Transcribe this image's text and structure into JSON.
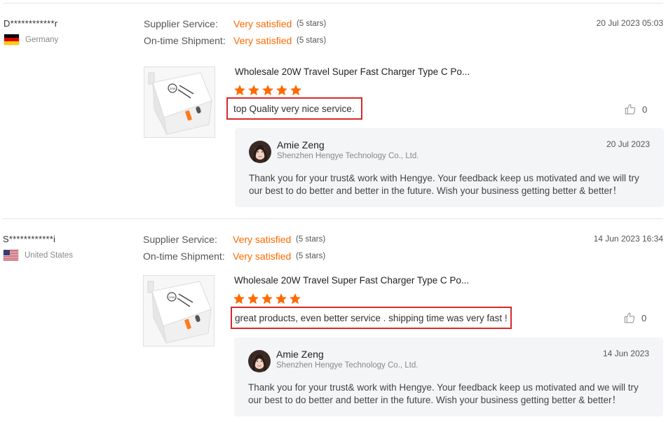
{
  "colors": {
    "accent": "#ff6a00",
    "highlight_border": "#d62a2a",
    "reply_bg": "#f4f5f7",
    "divider": "#e5e5e5"
  },
  "reviews": [
    {
      "buyer": "D************r",
      "country": "Germany",
      "flag_icon": "germany-flag-icon",
      "metrics": [
        {
          "label": "Supplier Service:",
          "value": "Very satisfied",
          "stars": "(5 stars)"
        },
        {
          "label": "On-time Shipment:",
          "value": "Very satisfied",
          "stars": "(5 stars)"
        }
      ],
      "date": "20 Jul 2023 05:03",
      "product_title": "Wholesale 20W Travel Super Fast Charger Type C Po...",
      "rating": 5,
      "feedback": "top Quality very nice service.",
      "likes": "0",
      "reply": {
        "seller_name": "Amie Zeng",
        "company": "Shenzhen Hengye Technology Co., Ltd.",
        "date": "20 Jul 2023",
        "text": "Thank you for your trust& work with Hengye. Your feedback keep us motivated and we will try our best to do better and better in the future. Wish your business getting better & better！"
      }
    },
    {
      "buyer": "S************i",
      "country": "United States",
      "flag_icon": "us-flag-icon",
      "metrics": [
        {
          "label": "Supplier Service:",
          "value": "Very satisfied",
          "stars": "(5 stars)"
        },
        {
          "label": "On-time Shipment:",
          "value": "Very satisfied",
          "stars": "(5 stars)"
        }
      ],
      "date": "14 Jun 2023 16:34",
      "product_title": "Wholesale 20W Travel Super Fast Charger Type C Po...",
      "rating": 5,
      "feedback": "great products, even better service . shipping time was very fast !",
      "likes": "0",
      "reply": {
        "seller_name": "Amie Zeng",
        "company": "Shenzhen Hengye Technology Co., Ltd.",
        "date": "14 Jun 2023",
        "text": "Thank you for your trust& work with Hengye. Your feedback keep us motivated and we will try our best to do better and better in the future. Wish your business getting better & better！"
      }
    }
  ]
}
